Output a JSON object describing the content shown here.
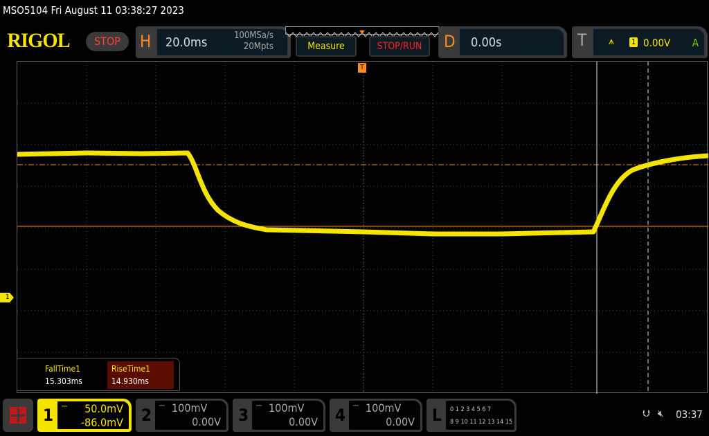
{
  "status_bar": {
    "title": "MSO5104  Fri August 11 03:38:27 2023"
  },
  "brand": {
    "logo": "RIGOL",
    "run_state": "STOP"
  },
  "horizontal": {
    "label": "H",
    "timebase": "20.0ms",
    "sample_rate": "100MSa/s",
    "memory_depth": "20Mpts"
  },
  "buttons": {
    "measure": "Measure",
    "stop_run": "STOP/RUN"
  },
  "delay": {
    "label": "D",
    "value": "0.00s"
  },
  "trigger": {
    "label": "T",
    "source": "1",
    "level": "0.00V",
    "mode": "A",
    "slope": "rising-edge-icon"
  },
  "measurements": [
    {
      "name": "FallTime1",
      "value": "15.303ms"
    },
    {
      "name": "RiseTime1",
      "value": "14.930ms"
    }
  ],
  "channels": [
    {
      "num": "1",
      "scale": "50.0mV",
      "offset": "-86.0mV",
      "active": true,
      "coupling": "dc-coupling-icon",
      "color": "#f5e400"
    },
    {
      "num": "2",
      "scale": "100mV",
      "offset": "0.00V",
      "active": false,
      "coupling": "dc-coupling-icon"
    },
    {
      "num": "3",
      "scale": "100mV",
      "offset": "0.00V",
      "active": false,
      "coupling": "dc-coupling-icon"
    },
    {
      "num": "4",
      "scale": "100mV",
      "offset": "0.00V",
      "active": false,
      "coupling": "dc-coupling-icon"
    }
  ],
  "logic": {
    "label": "L",
    "row1": "0 1 2 3  4 5 6 7",
    "row2": "8 9 10 11 12 13 14 15"
  },
  "system": {
    "clock": "03:37",
    "usb": "usb-icon",
    "sound": "muted-speaker-icon"
  },
  "waveform": {
    "channel_marker": "1",
    "trace_color": "#f5e400",
    "cursor_color": "#ff8a1a"
  }
}
